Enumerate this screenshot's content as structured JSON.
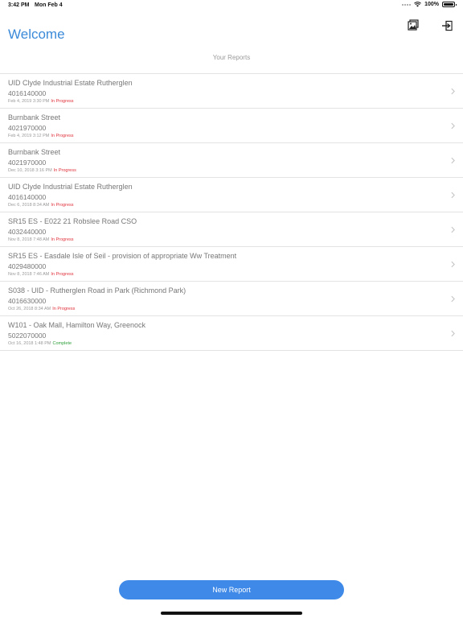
{
  "status_bar": {
    "time": "3:42 PM",
    "date": "Mon Feb 4",
    "battery": "100%"
  },
  "header": {
    "title": "Welcome",
    "icons": [
      "gallery-icon",
      "logout-icon"
    ]
  },
  "section": {
    "title": "Your Reports"
  },
  "reports": [
    {
      "name": "UID Clyde Industrial Estate Rutherglen",
      "number": "4016140000",
      "date": "Feb 4, 2019 3:30 PM",
      "status": "In Progress",
      "status_color": "#e0303a"
    },
    {
      "name": "Burnbank Street",
      "number": "4021970000",
      "date": "Feb 4, 2019 3:12 PM",
      "status": "In Progress",
      "status_color": "#e0303a"
    },
    {
      "name": "Burnbank Street",
      "number": "4021970000",
      "date": "Dec 10, 2018 3:16 PM",
      "status": "In Progress",
      "status_color": "#e0303a"
    },
    {
      "name": "UID Clyde Industrial Estate Rutherglen",
      "number": "4016140000",
      "date": "Dec 6, 2018 8:34 AM",
      "status": "In Progress",
      "status_color": "#e0303a"
    },
    {
      "name": "SR15 ES - E022 21 Robslee Road CSO",
      "number": "4032440000",
      "date": "Nov 8, 2018 7:48 AM",
      "status": "In Progress",
      "status_color": "#e0303a"
    },
    {
      "name": "SR15 ES - Easdale Isle of Seil - provision of appropriate Ww Treatment",
      "number": "4029480000",
      "date": "Nov 8, 2018 7:46 AM",
      "status": "In Progress",
      "status_color": "#e0303a"
    },
    {
      "name": "S038 - UID - Rutherglen Road in Park (Richmond Park)",
      "number": "4016630000",
      "date": "Oct 26, 2018 8:34 AM",
      "status": "In Progress",
      "status_color": "#e0303a"
    },
    {
      "name": "W101 - Oak Mall, Hamilton Way, Greenock",
      "number": "5022070000",
      "date": "Oct 16, 2018 1:48 PM",
      "status": "Complete",
      "status_color": "#2e9e3a"
    }
  ],
  "footer": {
    "new_report_label": "New Report",
    "accent_color": "#3f8ae8"
  }
}
